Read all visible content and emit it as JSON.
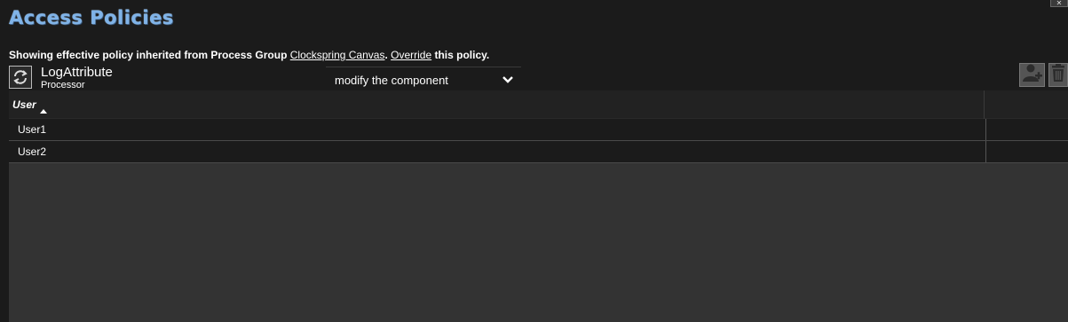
{
  "dialog": {
    "title": "Access Policies",
    "close_label": "✕"
  },
  "notice": {
    "prefix": "Showing effective policy inherited from Process Group ",
    "group_link": "Clockspring Canvas",
    "separator": ". ",
    "override_link": "Override",
    "suffix": " this policy."
  },
  "component": {
    "name": "LogAttribute",
    "type": "Processor",
    "icon": "processor-icon"
  },
  "policy_select": {
    "selected": "modify the component",
    "icon": "chevron-down-icon"
  },
  "actions": {
    "add_user_icon": "add-user-icon",
    "delete_icon": "trash-icon"
  },
  "table": {
    "columns": [
      {
        "label": "User",
        "sort": "ascending"
      }
    ],
    "rows": [
      {
        "user": "User1"
      },
      {
        "user": "User2"
      }
    ]
  },
  "colors": {
    "background": "#1b1b1b",
    "title": "#7fb3e8",
    "grid_empty": "#333333",
    "button": "#555555"
  }
}
